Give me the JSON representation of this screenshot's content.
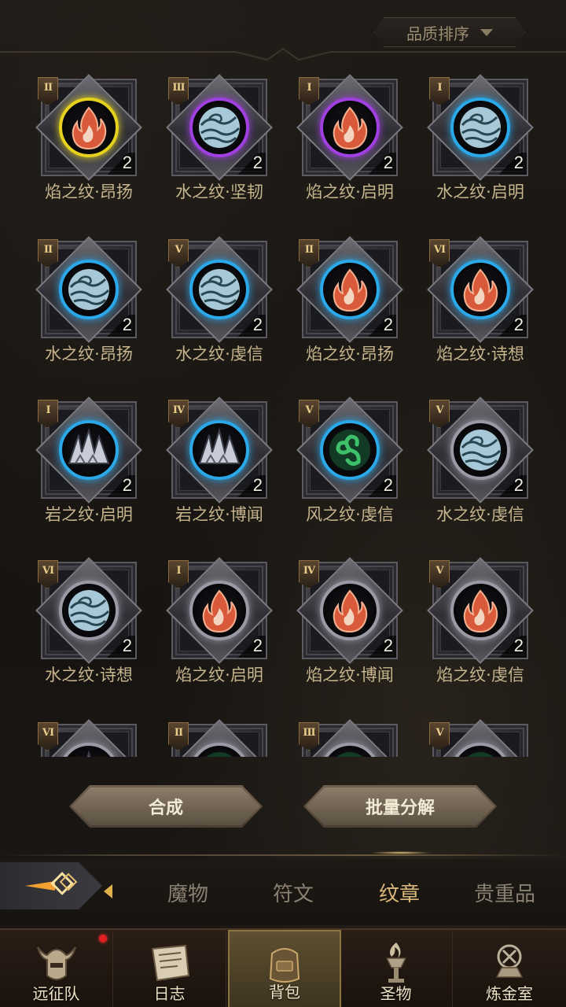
{
  "sort": {
    "label": "品质排序"
  },
  "items": [
    {
      "rank": "II",
      "name": "焰之纹·昂扬",
      "count": "2",
      "element": "fire",
      "ring": "#e6d21e"
    },
    {
      "rank": "III",
      "name": "水之纹·坚韧",
      "count": "2",
      "element": "water",
      "ring": "#a040e0"
    },
    {
      "rank": "I",
      "name": "焰之纹·启明",
      "count": "2",
      "element": "fire",
      "ring": "#a040e0"
    },
    {
      "rank": "I",
      "name": "水之纹·启明",
      "count": "2",
      "element": "water",
      "ring": "#2aa8e8"
    },
    {
      "rank": "II",
      "name": "水之纹·昂扬",
      "count": "2",
      "element": "water",
      "ring": "#2aa8e8"
    },
    {
      "rank": "V",
      "name": "水之纹·虔信",
      "count": "2",
      "element": "water",
      "ring": "#2aa8e8"
    },
    {
      "rank": "II",
      "name": "焰之纹·昂扬",
      "count": "2",
      "element": "fire",
      "ring": "#2aa8e8"
    },
    {
      "rank": "VI",
      "name": "焰之纹·诗想",
      "count": "2",
      "element": "fire",
      "ring": "#2aa8e8"
    },
    {
      "rank": "I",
      "name": "岩之纹·启明",
      "count": "2",
      "element": "rock",
      "ring": "#2aa8e8"
    },
    {
      "rank": "IV",
      "name": "岩之纹·博闻",
      "count": "2",
      "element": "rock",
      "ring": "#2aa8e8"
    },
    {
      "rank": "V",
      "name": "风之纹·虔信",
      "count": "2",
      "element": "wind",
      "ring": "#2aa8e8"
    },
    {
      "rank": "V",
      "name": "水之纹·虔信",
      "count": "2",
      "element": "water",
      "ring": "#9a9aa6"
    },
    {
      "rank": "VI",
      "name": "水之纹·诗想",
      "count": "2",
      "element": "water",
      "ring": "#9a9aa6"
    },
    {
      "rank": "I",
      "name": "焰之纹·启明",
      "count": "2",
      "element": "fire",
      "ring": "#9a9aa6"
    },
    {
      "rank": "IV",
      "name": "焰之纹·博闻",
      "count": "2",
      "element": "fire",
      "ring": "#9a9aa6"
    },
    {
      "rank": "V",
      "name": "焰之纹·虔信",
      "count": "2",
      "element": "fire",
      "ring": "#9a9aa6"
    },
    {
      "rank": "VI",
      "name": "",
      "count": "",
      "element": "rock",
      "ring": "#9a9aa6"
    },
    {
      "rank": "II",
      "name": "",
      "count": "",
      "element": "wind",
      "ring": "#9a9aa6"
    },
    {
      "rank": "III",
      "name": "",
      "count": "",
      "element": "wind",
      "ring": "#9a9aa6"
    },
    {
      "rank": "V",
      "name": "",
      "count": "",
      "element": "wind",
      "ring": "#9a9aa6"
    }
  ],
  "actions": {
    "compose": "合成",
    "batch_decompose": "批量分解"
  },
  "tabs": [
    "魔物",
    "符文",
    "纹章",
    "贵重品"
  ],
  "active_tab": "纹章",
  "nav": [
    {
      "label": "远征队",
      "icon": "helmet-icon"
    },
    {
      "label": "日志",
      "icon": "scroll-icon"
    },
    {
      "label": "背包",
      "icon": "backpack-icon"
    },
    {
      "label": "圣物",
      "icon": "torch-icon"
    },
    {
      "label": "炼金室",
      "icon": "alchemy-icon"
    }
  ],
  "active_nav": "背包",
  "colors": {
    "accent": "#d9b77a",
    "notification": "#e02020"
  }
}
